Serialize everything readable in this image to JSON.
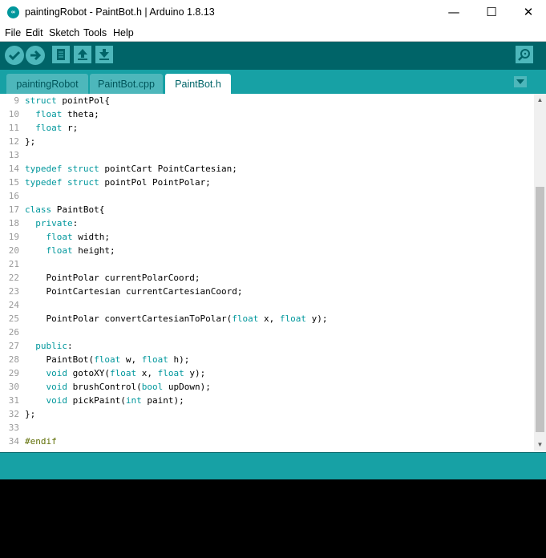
{
  "window": {
    "title": "paintingRobot - PaintBot.h | Arduino 1.8.13",
    "app_icon": "∞",
    "minimize": "—",
    "maximize": "☐",
    "close": "✕"
  },
  "menu": [
    "File",
    "Edit",
    "Sketch",
    "Tools",
    "Help"
  ],
  "toolbar": {
    "verify_icon": "✓",
    "upload_icon": "→",
    "new_icon": "new-file",
    "open_icon": "↑",
    "save_icon": "↓",
    "serial_icon": "serial-monitor"
  },
  "tabs": [
    "paintingRobot",
    "PaintBot.cpp",
    "PaintBot.h"
  ],
  "active_tab": "PaintBot.h",
  "tab_menu_icon": "▼",
  "editor": {
    "lines": [
      {
        "n": "9",
        "tokens": [
          {
            "t": "struct",
            "c": "kw"
          },
          {
            "t": " pointPol{"
          }
        ]
      },
      {
        "n": "10",
        "tokens": [
          {
            "t": "  "
          },
          {
            "t": "float",
            "c": "kw"
          },
          {
            "t": " theta;"
          }
        ]
      },
      {
        "n": "11",
        "tokens": [
          {
            "t": "  "
          },
          {
            "t": "float",
            "c": "kw"
          },
          {
            "t": " r;"
          }
        ]
      },
      {
        "n": "12",
        "tokens": [
          {
            "t": "};"
          }
        ]
      },
      {
        "n": "13",
        "tokens": []
      },
      {
        "n": "14",
        "tokens": [
          {
            "t": "typedef",
            "c": "kw"
          },
          {
            "t": " "
          },
          {
            "t": "struct",
            "c": "kw"
          },
          {
            "t": " pointCart PointCartesian;"
          }
        ]
      },
      {
        "n": "15",
        "tokens": [
          {
            "t": "typedef",
            "c": "kw"
          },
          {
            "t": " "
          },
          {
            "t": "struct",
            "c": "kw"
          },
          {
            "t": " pointPol PointPolar;"
          }
        ]
      },
      {
        "n": "16",
        "tokens": []
      },
      {
        "n": "17",
        "tokens": [
          {
            "t": "class",
            "c": "kw"
          },
          {
            "t": " PaintBot{"
          }
        ]
      },
      {
        "n": "18",
        "tokens": [
          {
            "t": "  "
          },
          {
            "t": "private",
            "c": "kw"
          },
          {
            "t": ":"
          }
        ]
      },
      {
        "n": "19",
        "tokens": [
          {
            "t": "    "
          },
          {
            "t": "float",
            "c": "kw"
          },
          {
            "t": " width;"
          }
        ]
      },
      {
        "n": "20",
        "tokens": [
          {
            "t": "    "
          },
          {
            "t": "float",
            "c": "kw"
          },
          {
            "t": " height;"
          }
        ]
      },
      {
        "n": "21",
        "tokens": []
      },
      {
        "n": "22",
        "tokens": [
          {
            "t": "    PointPolar currentPolarCoord;"
          }
        ]
      },
      {
        "n": "23",
        "tokens": [
          {
            "t": "    PointCartesian currentCartesianCoord;"
          }
        ]
      },
      {
        "n": "24",
        "tokens": []
      },
      {
        "n": "25",
        "tokens": [
          {
            "t": "    PointPolar convertCartesianToPolar("
          },
          {
            "t": "float",
            "c": "kw"
          },
          {
            "t": " x, "
          },
          {
            "t": "float",
            "c": "kw"
          },
          {
            "t": " y);"
          }
        ]
      },
      {
        "n": "26",
        "tokens": []
      },
      {
        "n": "27",
        "tokens": [
          {
            "t": "  "
          },
          {
            "t": "public",
            "c": "kw"
          },
          {
            "t": ":"
          }
        ]
      },
      {
        "n": "28",
        "tokens": [
          {
            "t": "    PaintBot("
          },
          {
            "t": "float",
            "c": "kw"
          },
          {
            "t": " w, "
          },
          {
            "t": "float",
            "c": "kw"
          },
          {
            "t": " h);"
          }
        ]
      },
      {
        "n": "29",
        "tokens": [
          {
            "t": "    "
          },
          {
            "t": "void",
            "c": "kw"
          },
          {
            "t": " gotoXY("
          },
          {
            "t": "float",
            "c": "kw"
          },
          {
            "t": " x, "
          },
          {
            "t": "float",
            "c": "kw"
          },
          {
            "t": " y);"
          }
        ]
      },
      {
        "n": "30",
        "tokens": [
          {
            "t": "    "
          },
          {
            "t": "void",
            "c": "kw"
          },
          {
            "t": " brushControl("
          },
          {
            "t": "bool",
            "c": "kw"
          },
          {
            "t": " upDown);"
          }
        ]
      },
      {
        "n": "31",
        "tokens": [
          {
            "t": "    "
          },
          {
            "t": "void",
            "c": "kw"
          },
          {
            "t": " pickPaint("
          },
          {
            "t": "int",
            "c": "kw"
          },
          {
            "t": " paint);"
          }
        ]
      },
      {
        "n": "32",
        "tokens": [
          {
            "t": "};"
          }
        ]
      },
      {
        "n": "33",
        "tokens": []
      },
      {
        "n": "34",
        "tokens": [
          {
            "t": "#endif",
            "c": "pp"
          }
        ]
      }
    ]
  },
  "scrollbar": {
    "up": "▲",
    "down": "▼"
  },
  "colors": {
    "accent_dark": "#006468",
    "accent": "#17a1a5",
    "keyword": "#00979c",
    "preprocessor": "#5e6d03",
    "console_bg": "#000000"
  }
}
